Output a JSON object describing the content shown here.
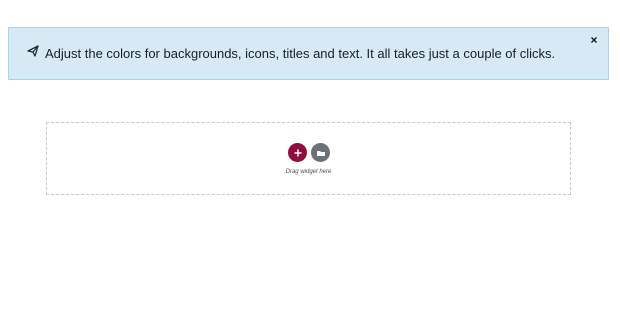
{
  "notice": {
    "message": "Adjust the colors for backgrounds, icons, titles and text. It all takes just a couple of clicks.",
    "close_label": "×",
    "icon": "paper-plane-icon"
  },
  "drop_zone": {
    "label": "Drag widget here",
    "add_button_icon": "plus-icon",
    "template_button_icon": "folder-icon",
    "add_button_color": "#8e0f3f",
    "template_button_color": "#6b7278"
  }
}
